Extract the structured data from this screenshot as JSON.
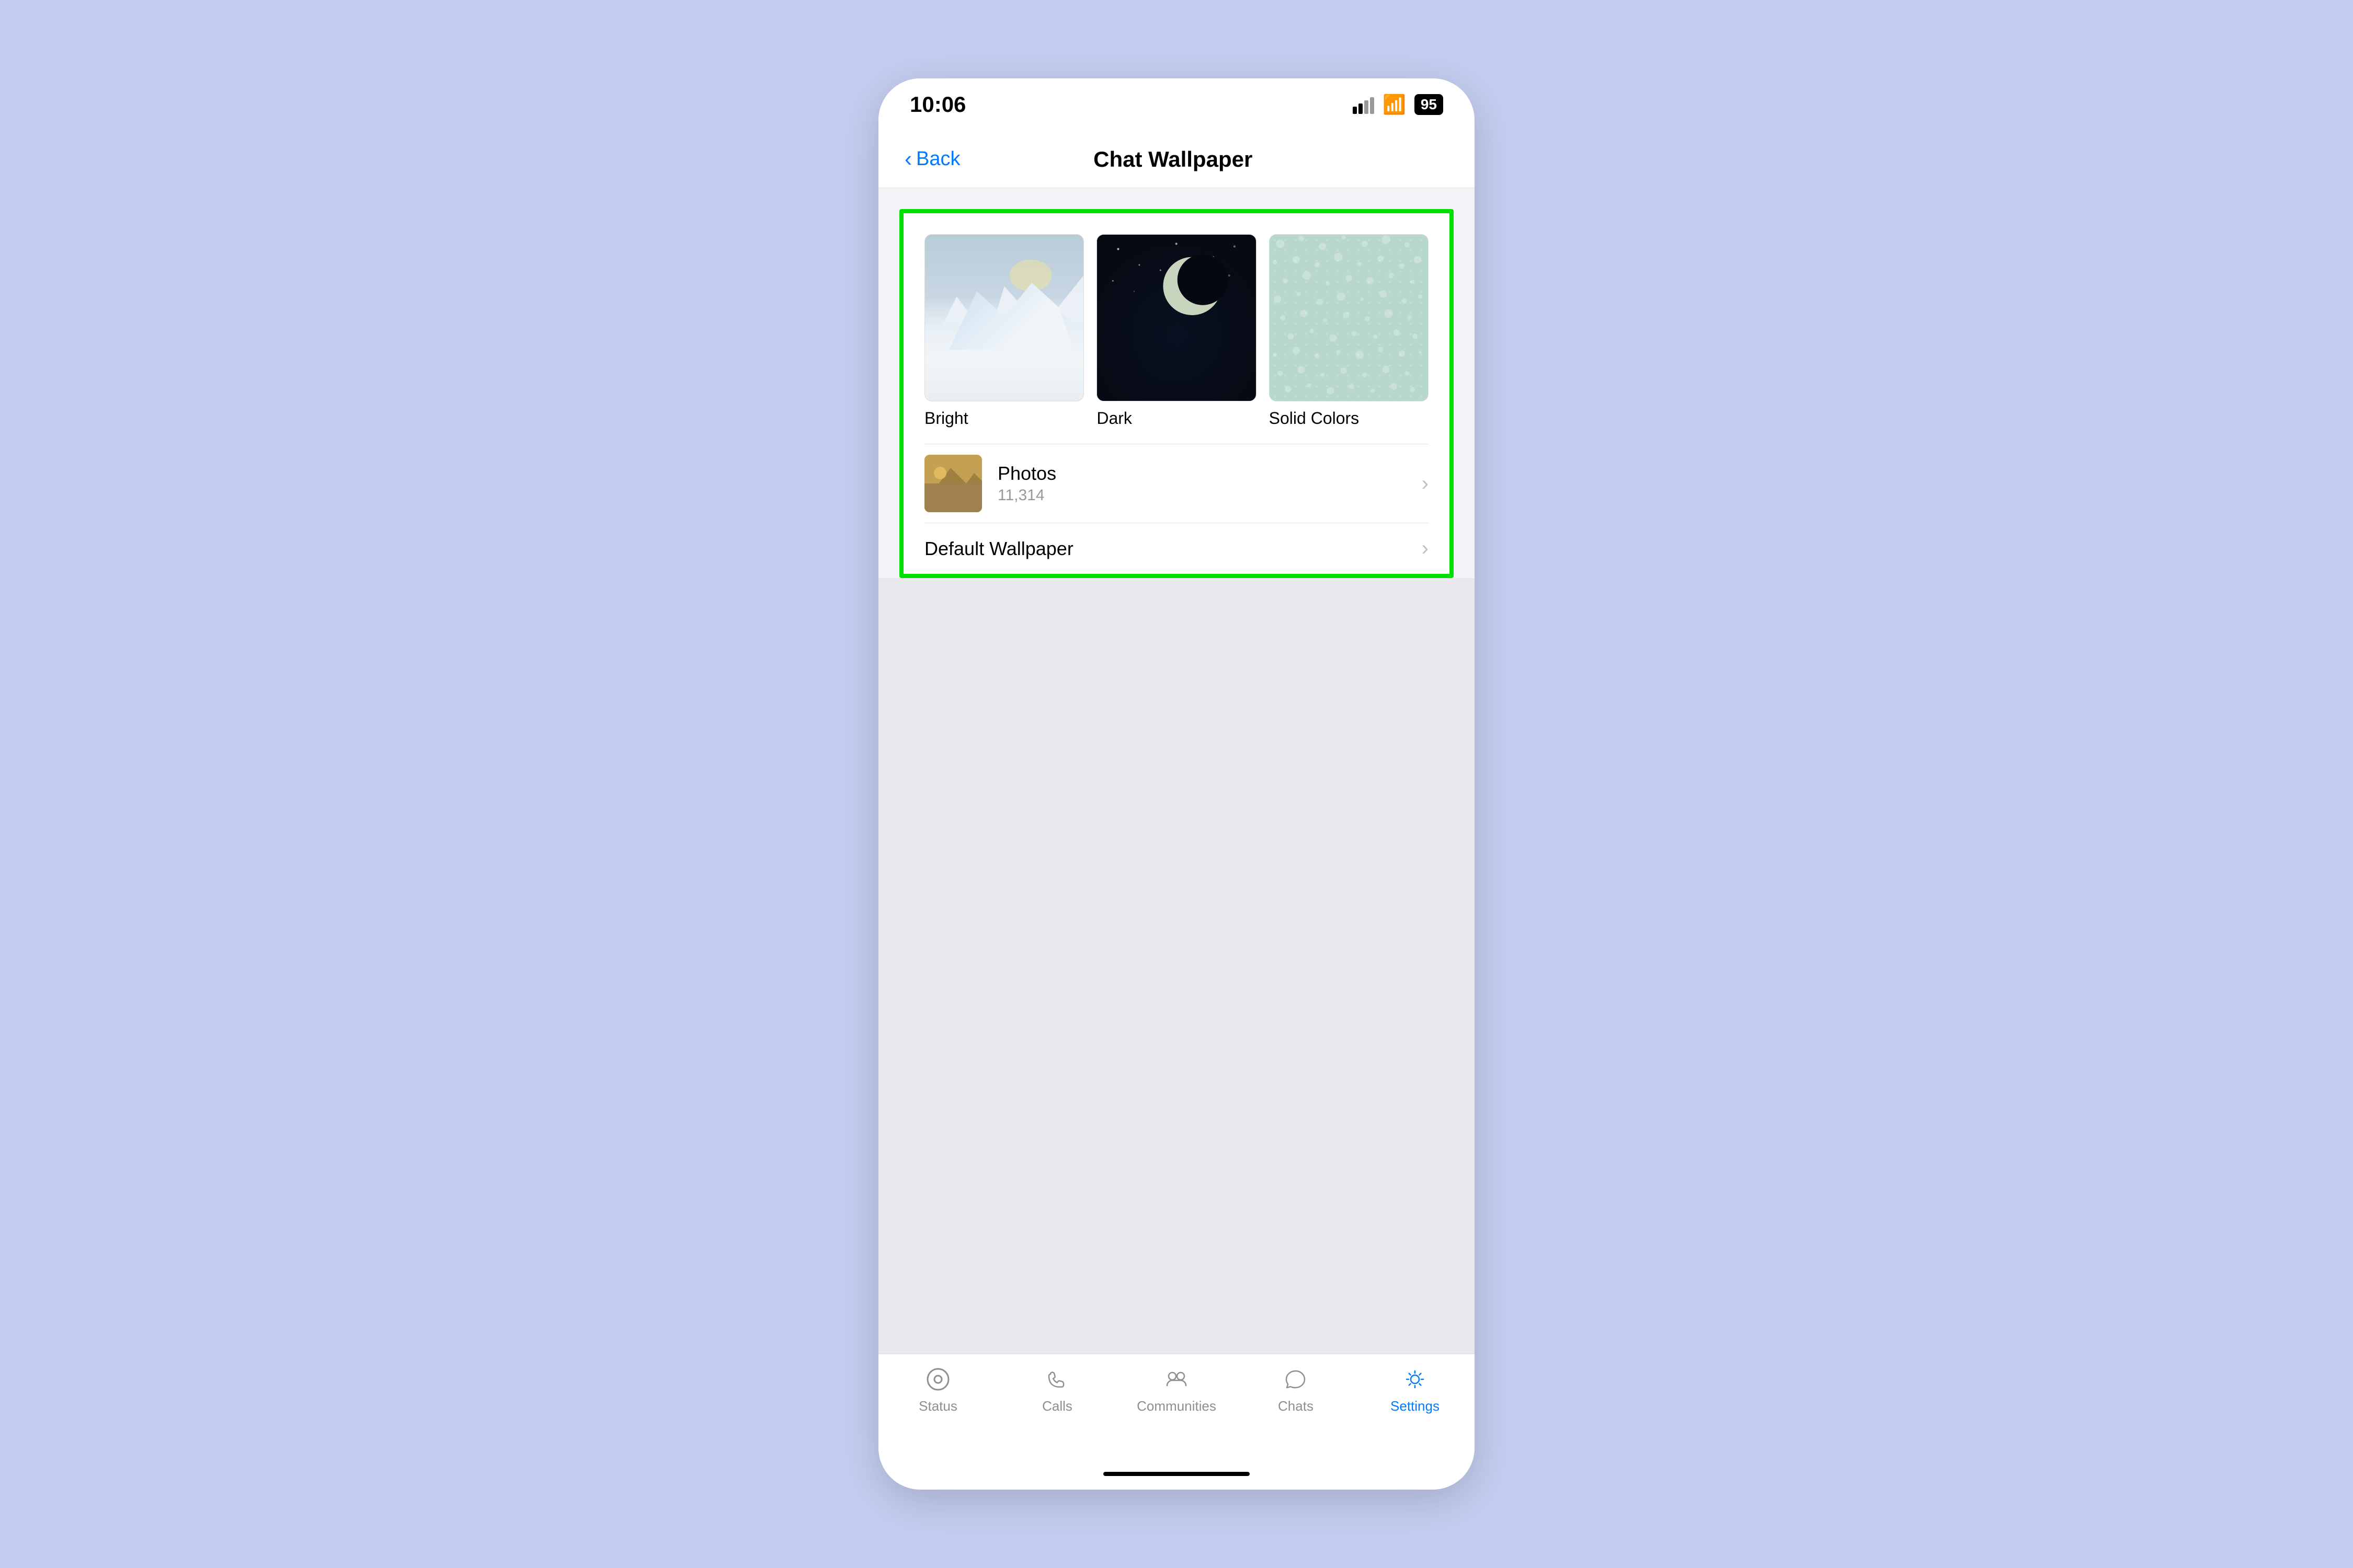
{
  "status_bar": {
    "time": "10:06",
    "battery": "95"
  },
  "nav": {
    "back_label": "Back",
    "title": "Chat Wallpaper"
  },
  "wallpaper_options": [
    {
      "id": "bright",
      "label": "Bright"
    },
    {
      "id": "dark",
      "label": "Dark"
    },
    {
      "id": "solid",
      "label": "Solid Colors"
    }
  ],
  "photos_row": {
    "title": "Photos",
    "subtitle": "11,314",
    "chevron": "›"
  },
  "default_row": {
    "title": "Default Wallpaper",
    "chevron": "›"
  },
  "tab_bar": {
    "items": [
      {
        "id": "status",
        "label": "Status",
        "active": false
      },
      {
        "id": "calls",
        "label": "Calls",
        "active": false
      },
      {
        "id": "communities",
        "label": "Communities",
        "active": false
      },
      {
        "id": "chats",
        "label": "Chats",
        "active": false
      },
      {
        "id": "settings",
        "label": "Settings",
        "active": true
      }
    ]
  }
}
